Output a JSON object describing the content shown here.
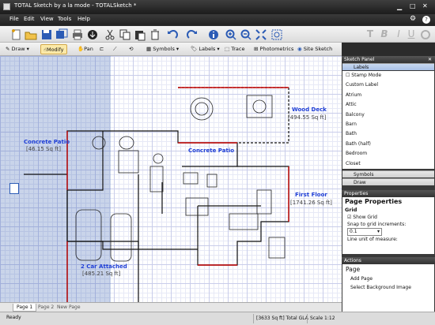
{
  "app": {
    "title": "TOTAL Sketch by a la mode - TOTALSketch *"
  },
  "menu": [
    "File",
    "Edit",
    "View",
    "Tools",
    "Help"
  ],
  "toolbar2": {
    "draw": "Draw",
    "modify": "Modify",
    "pan": "Pan",
    "symbols": "Symbols",
    "labels": "Labels",
    "trace": "Trace",
    "photometrics": "Photometrics",
    "site_sketch": "Site Sketch"
  },
  "canvas": {
    "labels": [
      {
        "name": "Concrete Patio",
        "area": "[46.15 Sq ft]"
      },
      {
        "name": "Wood Deck",
        "area": "[494.55 Sq ft]"
      },
      {
        "name": "Concrete Patio",
        "area": ""
      },
      {
        "name": "First Floor",
        "area": "[1741.26 Sq ft]"
      },
      {
        "name": "2 Car Attached",
        "area": "[485.21 Sq ft]"
      }
    ]
  },
  "pages": [
    "Page 1",
    "Page 2",
    "New Page"
  ],
  "status": {
    "ready": "Ready",
    "gla": "[3633 Sq ft] Total GLA",
    "scale": "Scale 1:12"
  },
  "sketch_panel": {
    "title": "Sketch Panel",
    "tab": "Labels",
    "items": [
      "Stamp Mode",
      "Custom Label",
      "Atrium",
      "Attic",
      "Balcony",
      "Barn",
      "Bath",
      "Bath (half)",
      "Bedroom",
      "Closet"
    ],
    "tabs": [
      "Symbols",
      "Draw"
    ]
  },
  "properties": {
    "title": "Properties",
    "heading": "Page Properties",
    "grid": "Grid",
    "show_grid": "Show Grid",
    "snap": "Snap to grid increments:",
    "snap_value": "0.1",
    "line_unit": "Line unit of measure:"
  },
  "actions": {
    "title": "Actions",
    "heading": "Page",
    "items": [
      "Add Page",
      "Select Background Image"
    ]
  },
  "colors": {
    "accent": "#1f3fd6",
    "selection": "#3c64b4",
    "wall": "#c00000"
  }
}
